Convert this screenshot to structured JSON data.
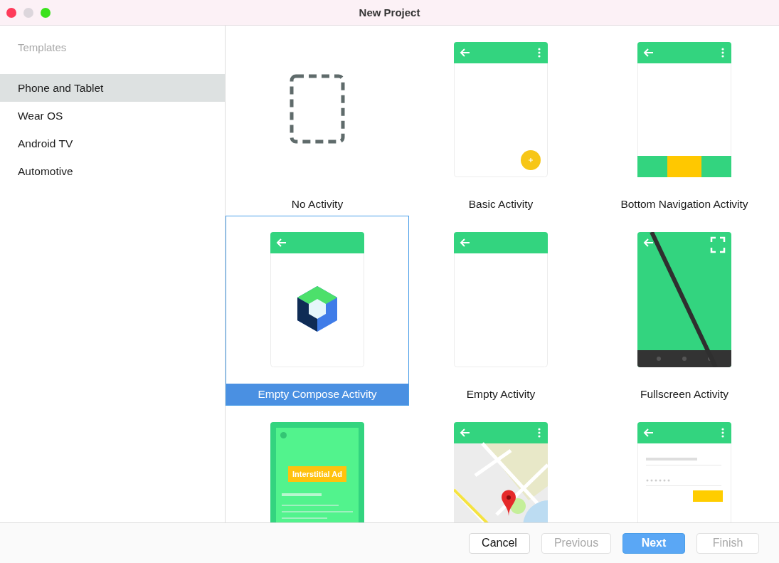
{
  "window": {
    "title": "New Project"
  },
  "sidebar": {
    "heading": "Templates",
    "items": [
      {
        "label": "Phone and Tablet",
        "selected": true
      },
      {
        "label": "Wear OS",
        "selected": false
      },
      {
        "label": "Android TV",
        "selected": false
      },
      {
        "label": "Automotive",
        "selected": false
      }
    ]
  },
  "templates": [
    {
      "kind": "none",
      "label": "No Activity",
      "selected": false
    },
    {
      "kind": "basic",
      "label": "Basic Activity",
      "selected": false
    },
    {
      "kind": "bottomnav",
      "label": "Bottom Navigation Activity",
      "selected": false
    },
    {
      "kind": "compose",
      "label": "Empty Compose Activity",
      "selected": true
    },
    {
      "kind": "empty",
      "label": "Empty Activity",
      "selected": false
    },
    {
      "kind": "fullscreen",
      "label": "Fullscreen Activity",
      "selected": false
    },
    {
      "kind": "ad",
      "badge": "Interstitial Ad",
      "selected": false
    },
    {
      "kind": "map",
      "selected": false
    },
    {
      "kind": "login",
      "selected": false
    }
  ],
  "buttons": [
    {
      "label": "Cancel",
      "kind": "default",
      "disabled": false
    },
    {
      "label": "Previous",
      "kind": "default",
      "disabled": true
    },
    {
      "label": "Next",
      "kind": "primary",
      "disabled": false
    },
    {
      "label": "Finish",
      "kind": "default",
      "disabled": true
    }
  ]
}
